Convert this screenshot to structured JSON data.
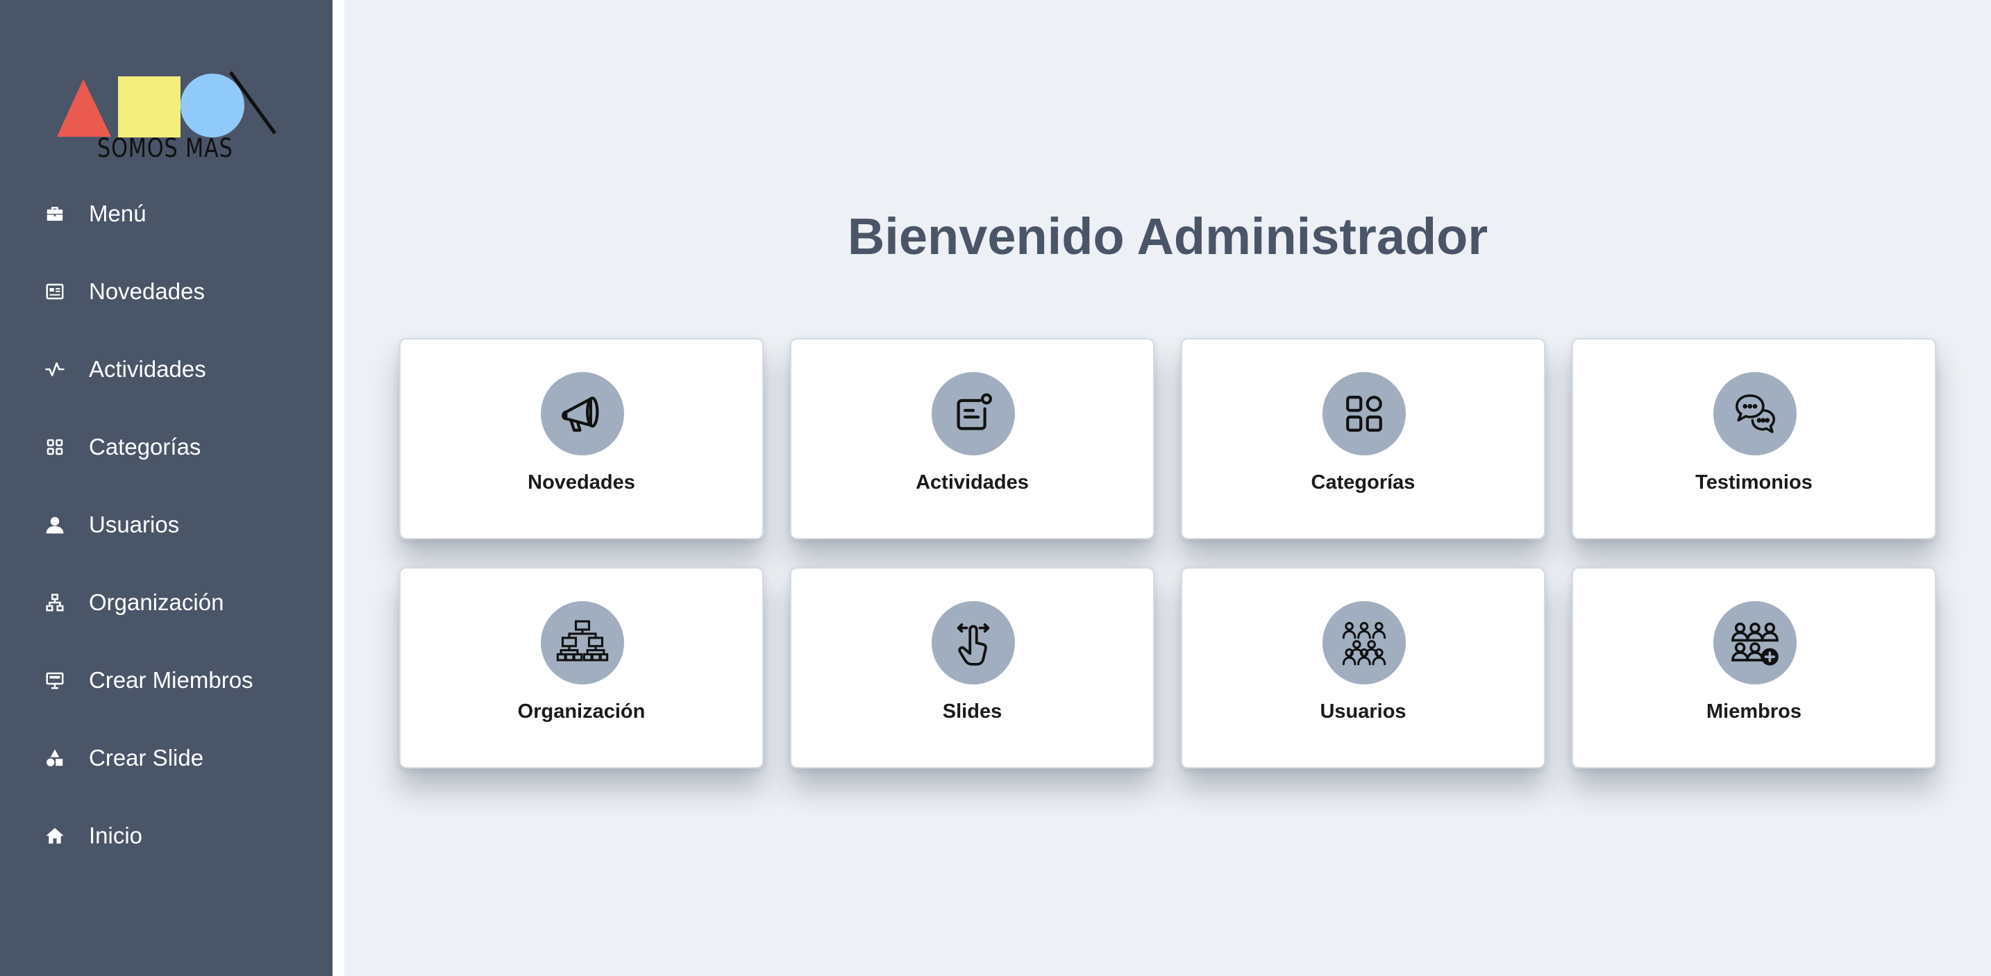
{
  "sidebar": {
    "logo_text": "SOMOS MAS",
    "items": [
      {
        "label": "Menú",
        "icon": "briefcase-icon"
      },
      {
        "label": "Novedades",
        "icon": "newspaper-icon"
      },
      {
        "label": "Actividades",
        "icon": "activity-icon"
      },
      {
        "label": "Categorías",
        "icon": "grid-icon"
      },
      {
        "label": "Usuarios",
        "icon": "user-icon"
      },
      {
        "label": "Organización",
        "icon": "sitemap-icon"
      },
      {
        "label": "Crear Miembros",
        "icon": "presentation-icon"
      },
      {
        "label": "Crear Slide",
        "icon": "shapes-icon"
      },
      {
        "label": "Inicio",
        "icon": "home-icon"
      }
    ]
  },
  "main": {
    "title": "Bienvenido Administrador",
    "cards": [
      {
        "label": "Novedades",
        "icon": "megaphone-icon"
      },
      {
        "label": "Actividades",
        "icon": "activity-note-icon"
      },
      {
        "label": "Categorías",
        "icon": "categories-icon"
      },
      {
        "label": "Testimonios",
        "icon": "chat-bubbles-icon"
      },
      {
        "label": "Organización",
        "icon": "org-chart-icon"
      },
      {
        "label": "Slides",
        "icon": "swipe-hand-icon"
      },
      {
        "label": "Usuarios",
        "icon": "users-group-icon"
      },
      {
        "label": "Miembros",
        "icon": "add-members-icon"
      }
    ]
  },
  "colors": {
    "sidebar_bg": "#4a5568",
    "main_bg": "#edf1f5",
    "icon_circle": "#a0aec0",
    "title_color": "#4a5568"
  }
}
